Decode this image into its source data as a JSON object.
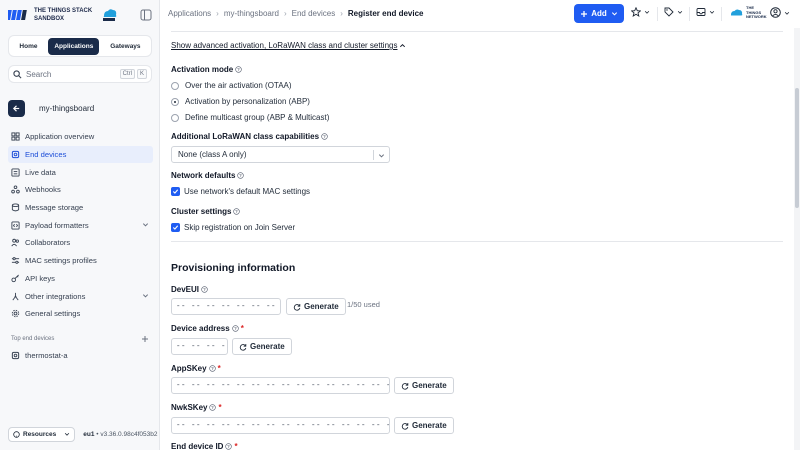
{
  "brand": {
    "name_line1": "THE THINGS STACK",
    "name_line2": "SANDBOX",
    "cloud_label": "THE THINGS NETWORK",
    "colors": {
      "primary": "#1f5cf2",
      "navy": "#1a2b49",
      "required": "#dc2626"
    }
  },
  "sidebar": {
    "tabs": [
      {
        "label": "Home",
        "active": false
      },
      {
        "label": "Applications",
        "active": true
      },
      {
        "label": "Gateways",
        "active": false
      }
    ],
    "search": {
      "placeholder": "Search",
      "kbd1": "Ctrl",
      "kbd2": "K"
    },
    "app_name": "my-thingsboard",
    "nav_items": [
      {
        "label": "Application overview",
        "icon": "grid-icon",
        "active": false
      },
      {
        "label": "End devices",
        "icon": "device-icon",
        "active": true
      },
      {
        "label": "Live data",
        "icon": "list-icon",
        "active": false
      },
      {
        "label": "Webhooks",
        "icon": "webhook-icon",
        "active": false
      },
      {
        "label": "Message storage",
        "icon": "database-icon",
        "active": false
      },
      {
        "label": "Payload formatters",
        "icon": "code-icon",
        "active": false,
        "expandable": true
      },
      {
        "label": "Collaborators",
        "icon": "people-icon",
        "active": false
      },
      {
        "label": "MAC settings profiles",
        "icon": "sliders-icon",
        "active": false
      },
      {
        "label": "API keys",
        "icon": "key-icon",
        "active": false
      },
      {
        "label": "Other integrations",
        "icon": "integrations-icon",
        "active": false,
        "expandable": true
      },
      {
        "label": "General settings",
        "icon": "gear-icon",
        "active": false
      }
    ],
    "top_devices_label": "Top end devices",
    "top_devices": [
      {
        "label": "thermostat-a",
        "icon": "device-icon"
      }
    ],
    "resources_label": "Resources",
    "cluster": "eu1",
    "version": "v3.36.0.98c4f053b2"
  },
  "header": {
    "breadcrumbs": [
      "Applications",
      "my-thingsboard",
      "End devices",
      "Register end device"
    ],
    "add_label": "Add"
  },
  "form": {
    "advanced_link": "Show advanced activation, LoRaWAN class and cluster settings",
    "activation_mode_label": "Activation mode",
    "activation_options": [
      {
        "label": "Over the air activation (OTAA)",
        "checked": false
      },
      {
        "label": "Activation by personalization (ABP)",
        "checked": true
      },
      {
        "label": "Define multicast group (ABP & Multicast)",
        "checked": false
      }
    ],
    "class_label": "Additional LoRaWAN class capabilities",
    "class_value": "None (class A only)",
    "network_defaults_label": "Network defaults",
    "network_defaults_check": "Use network's default MAC settings",
    "cluster_settings_label": "Cluster settings",
    "cluster_settings_check": "Skip registration on Join Server",
    "provisioning_title": "Provisioning information",
    "deveui_label": "DevEUI",
    "deveui_value": "-- -- -- -- -- -- -- --",
    "generate_label": "Generate",
    "deveui_usage": "1/50 used",
    "device_address_label": "Device address",
    "device_address_value": "-- -- -- --",
    "appskey_label": "AppSKey",
    "appskey_value": "-- -- -- -- -- -- -- -- -- -- -- -- -- -- -- --",
    "nwkskey_label": "NwkSKey",
    "nwkskey_value": "-- -- -- -- -- -- -- -- -- -- -- -- -- -- -- --",
    "end_device_id_label": "End device ID"
  }
}
